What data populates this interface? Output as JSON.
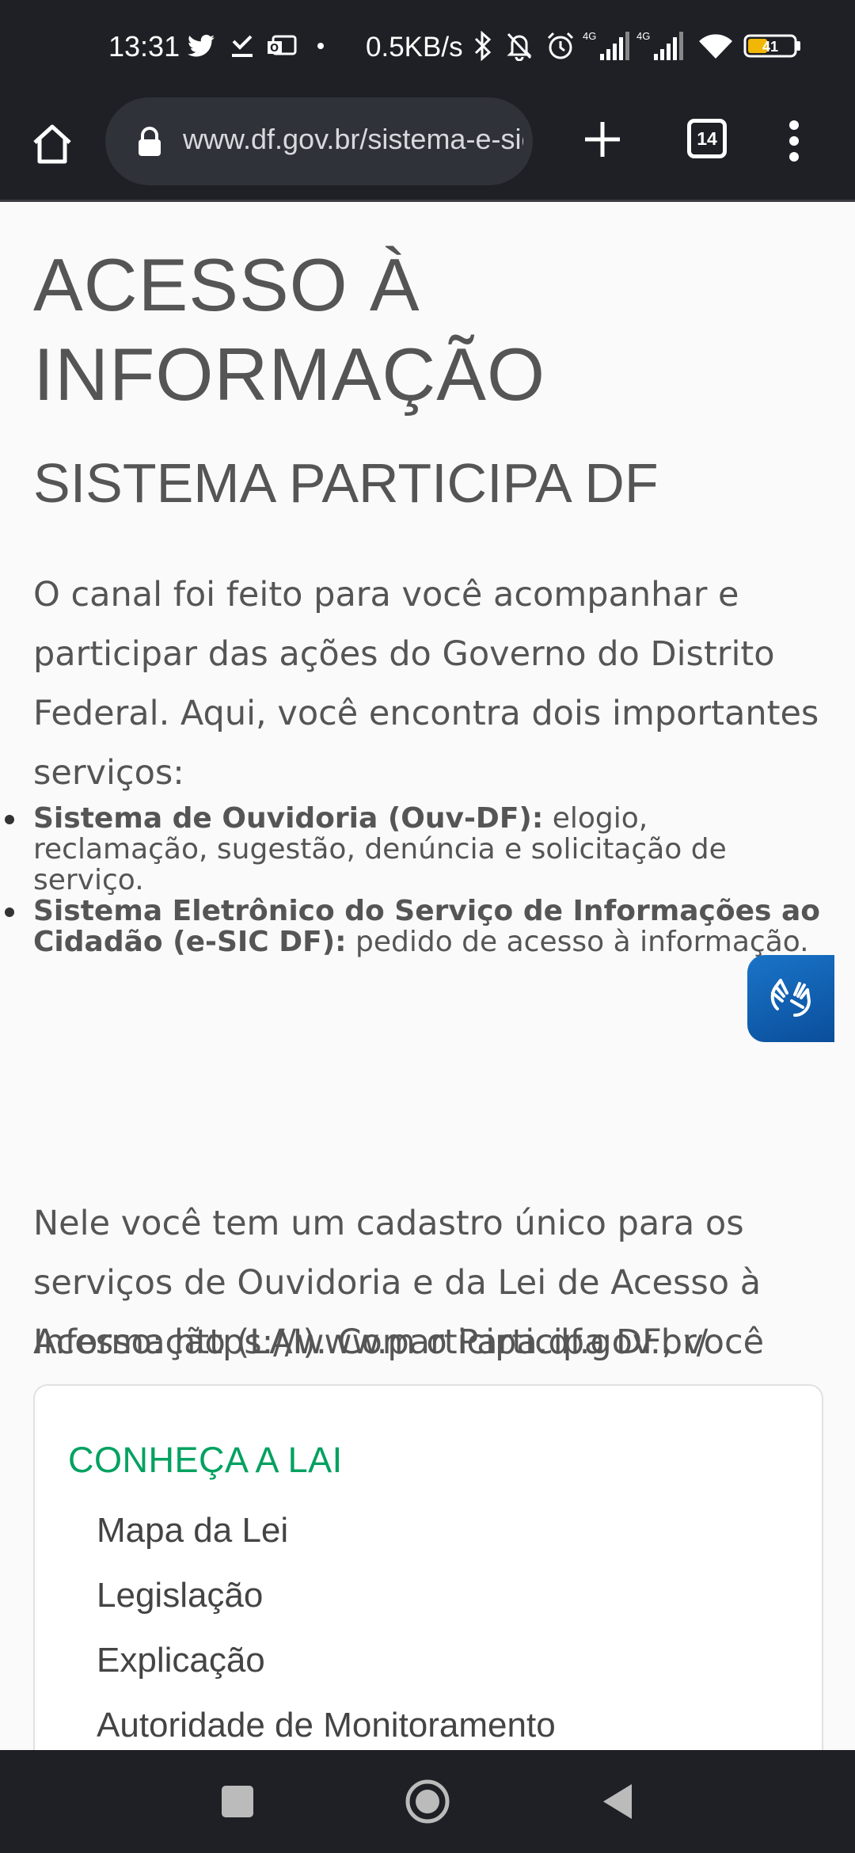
{
  "status_bar": {
    "time": "13:31",
    "net_speed": "0.5KB/s",
    "signal_1_label": "4G",
    "signal_2_label": "4G",
    "battery": "41",
    "icons": [
      "twitter-icon",
      "check-icon",
      "mail-icon",
      "dot-icon",
      "bluetooth-icon",
      "bell-off-icon",
      "alarm-icon",
      "signal-icon",
      "signal-icon",
      "wifi-icon",
      "battery-icon"
    ]
  },
  "browser": {
    "url": "www.df.gov.br/sistema-e-sic",
    "tab_count": "14",
    "icons": [
      "home-icon",
      "lock-icon",
      "plus-icon",
      "tabs-icon",
      "more-vert-icon"
    ]
  },
  "page": {
    "title_line1": "ACESSO À",
    "title_line2": "INFORMAÇÃO",
    "subtitle": "SISTEMA PARTICIPA DF",
    "intro": "O canal foi feito para você acompanhar e participar das ações do Governo do Distrito Federal. Aqui, você encontra dois importantes serviços:",
    "services": [
      {
        "name": "Sistema de Ouvidoria (Ouv-DF):",
        "desc": " elogio, reclamação, sugestão, denúncia e solicitação de serviço."
      },
      {
        "name": "Sistema Eletrônico do Serviço de Informações ao Cidadão (e-SIC DF):",
        "desc": " pedido de acesso à informação."
      }
    ],
    "body": "Nele você tem um cadastro único para os serviços de Ouvidoria e da Lei de Acesso à Informação (LAI). Com o Participa DF, você encontra esses dois serviços em um só lugar.",
    "access": "Acesso: https://www.participa.df.gov.br/",
    "lai": {
      "title": "CONHEÇA A LAI",
      "items": [
        "Mapa da Lei",
        "Legislação",
        "Explicação",
        "Autoridade de Monitoramento"
      ]
    }
  },
  "colors": {
    "system_bar": "#1e2025",
    "text": "#555555",
    "lai_title": "#00a160",
    "vlibras": "#0a5ea8"
  }
}
